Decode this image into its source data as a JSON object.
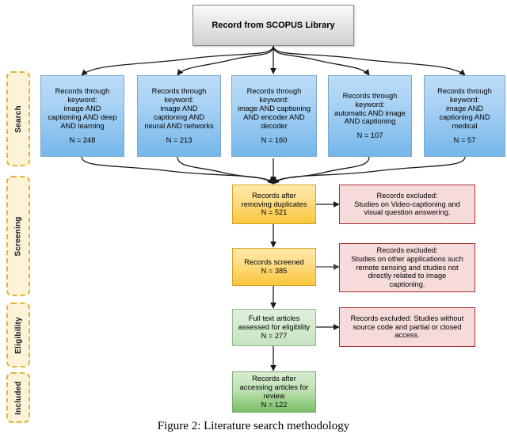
{
  "figure": {
    "caption": "Figure 2: Literature search methodology"
  },
  "source": {
    "label": "Record from SCOPUS Library"
  },
  "stages": [
    {
      "id": "search",
      "label": "Search"
    },
    {
      "id": "screening",
      "label": "Screening"
    },
    {
      "id": "eligibility",
      "label": "Eligibility"
    },
    {
      "id": "included",
      "label": "Included"
    }
  ],
  "search_boxes": [
    {
      "id": "deep-learning",
      "line1": "Records through",
      "line2": "keyword:",
      "line3": "image AND",
      "line4": "captioning AND deep",
      "line5": "AND learning",
      "count": "N = 248"
    },
    {
      "id": "neural-networks",
      "line1": "Records through",
      "line2": "keyword:",
      "line3": "image AND",
      "line4": "captioning AND",
      "line5": "neural AND networks",
      "count": "N = 213"
    },
    {
      "id": "encoder-decoder",
      "line1": "Records through",
      "line2": "keyword:",
      "line3": "image AND captioning",
      "line4": "AND encoder AND",
      "line5": "decoder",
      "count": "N = 160"
    },
    {
      "id": "automatic-image",
      "line1": "Records through",
      "line2": "keyword:",
      "line3": "automatic AND image",
      "line4": "AND captioning",
      "line5": "",
      "count": "N = 107"
    },
    {
      "id": "medical",
      "line1": "Records through",
      "line2": "keyword:",
      "line3": "image AND",
      "line4": "captioning AND",
      "line5": "medical",
      "count": "N = 57"
    }
  ],
  "flow": {
    "duplicates": {
      "line1": "Records after",
      "line2": "removing duplicates",
      "count": "N = 521"
    },
    "screened": {
      "line1": "Records screened",
      "count": "N = 385"
    },
    "fulltext": {
      "line1": "Full text articles",
      "line2": "assessed for eligibility",
      "count": "N = 277"
    },
    "included": {
      "line1": "Records after",
      "line2": "accessing articles for",
      "line3": "review",
      "count": "N = 122"
    }
  },
  "excluded": {
    "duplicates": {
      "line1": "Records excluded:",
      "line2": "Studies on Video-captioning and",
      "line3": "visual question answering."
    },
    "screened": {
      "line1": "Records excluded:",
      "line2": "Studies on other applications such",
      "line3": "remote sensing and studies not",
      "line4": "directly related to image",
      "line5": "captioning."
    },
    "fulltext": {
      "line1": "Records excluded: Studies without",
      "line2": "source code and partial or closed",
      "line3": "access."
    }
  },
  "colors": {
    "source_fill": "#e2e2e2",
    "search_fill": "#8ec5ef",
    "screening_fill": "#ffd866",
    "eligibility_fill": "#d4ead0",
    "included_fill": "#9ed18a",
    "excluded_fill": "#f6dbdb",
    "excluded_border": "#a93030",
    "stage_fill": "#fdf3d8",
    "stage_border": "#e3b33c",
    "arrow": "#1a1a1a"
  }
}
